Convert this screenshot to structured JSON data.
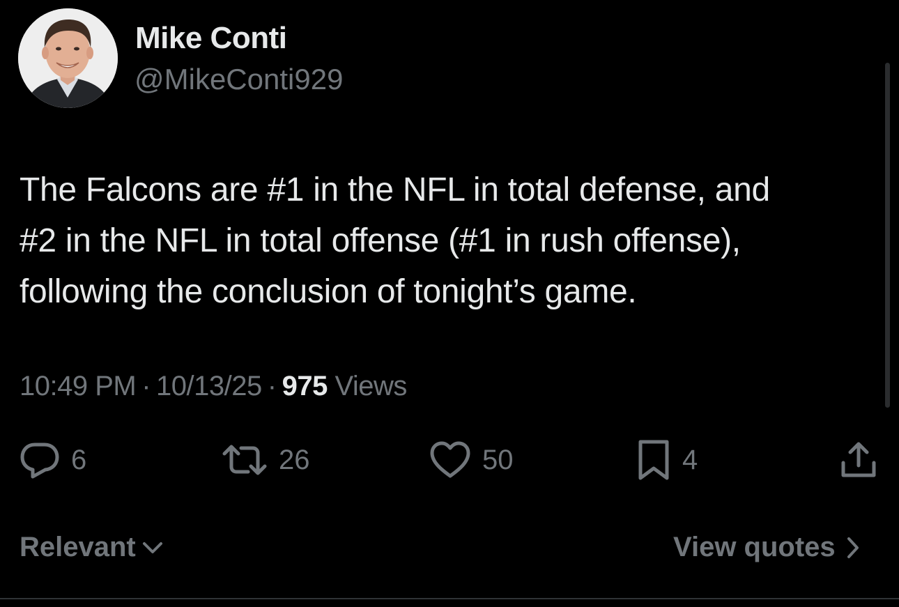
{
  "author": {
    "name": "Mike Conti",
    "handle": "@MikeConti929"
  },
  "tweet": {
    "lines": [
      "The Falcons are #1 in the NFL in total defense, and",
      "#2 in the NFL in total offense (#1 in rush offense),",
      "following the conclusion of tonight’s game."
    ]
  },
  "meta": {
    "time": "10:49 PM",
    "separator": "·",
    "date": "10/13/25",
    "views_count": "975",
    "views_label": "Views"
  },
  "actions": {
    "replies": "6",
    "reposts": "26",
    "likes": "50",
    "bookmarks": "4"
  },
  "footer": {
    "sort_label": "Relevant",
    "view_quotes_label": "View quotes"
  },
  "icons": {
    "reply": "reply-icon",
    "repost": "repost-icon",
    "like": "heart-icon",
    "bookmark": "bookmark-icon",
    "share": "share-icon",
    "sort": "chevron-down-icon",
    "view_quotes": "chevron-right-icon"
  },
  "colors": {
    "background": "#000000",
    "primary_text": "#e7e9ea",
    "secondary_text": "#71767b"
  }
}
